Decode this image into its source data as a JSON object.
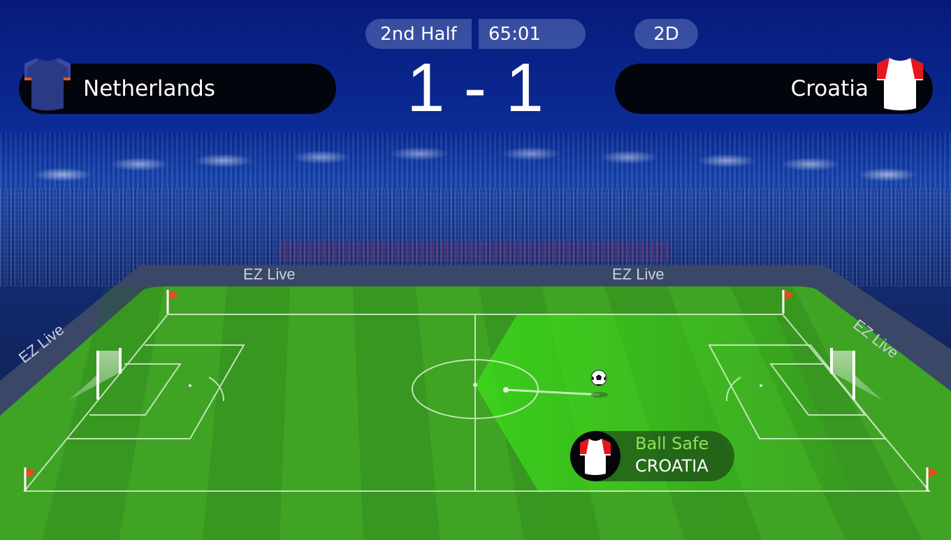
{
  "header": {
    "period": "2nd Half",
    "clock": "65:01",
    "view_toggle": "2D",
    "score": "1 - 1"
  },
  "teams": {
    "home": {
      "name": "Netherlands",
      "shirt_icon": "navy-shirt-icon",
      "shirt_color": "#2b3a86"
    },
    "away": {
      "name": "Croatia",
      "shirt_icon": "red-white-shirt-icon",
      "shirt_color": "#ffffff",
      "shirt_accent": "#e5161d"
    }
  },
  "pitch": {
    "ad_boards": [
      "EZ Live",
      "EZ Live",
      "EZ Live",
      "EZ Live"
    ],
    "grass_color": "#3fa324",
    "possession_highlight": "#39d21c"
  },
  "event": {
    "status": "Ball Safe",
    "team": "CROATIA",
    "status_color": "#8ee25a"
  }
}
